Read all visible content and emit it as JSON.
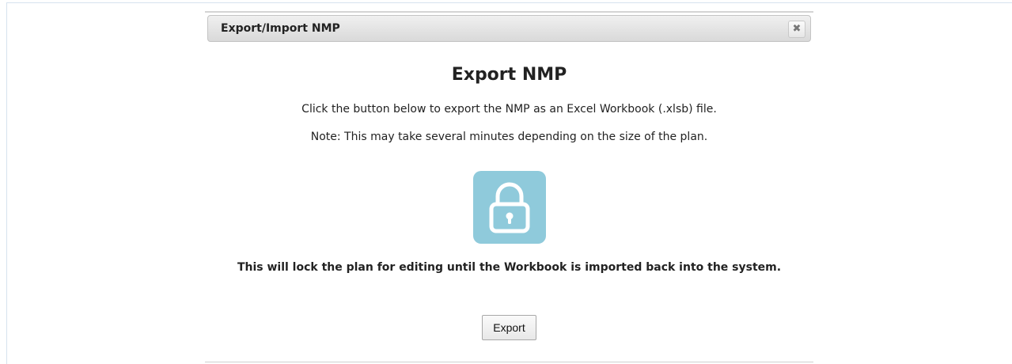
{
  "dialog": {
    "title": "Export/Import NMP",
    "close_label": "✖"
  },
  "content": {
    "heading": "Export NMP",
    "instruction": "Click the button below to export the NMP as an Excel Workbook (.xlsb) file.",
    "note": "Note: This may take several minutes depending on the size of the plan.",
    "lock_icon": "lock-icon",
    "warning": "This will lock the plan for editing until the Workbook is imported back into the system.",
    "export_label": "Export"
  },
  "colors": {
    "lock_tile": "#8fcadb",
    "titlebar_top": "#f0f0f0",
    "titlebar_bottom": "#d9d9d9",
    "text": "#222222"
  }
}
